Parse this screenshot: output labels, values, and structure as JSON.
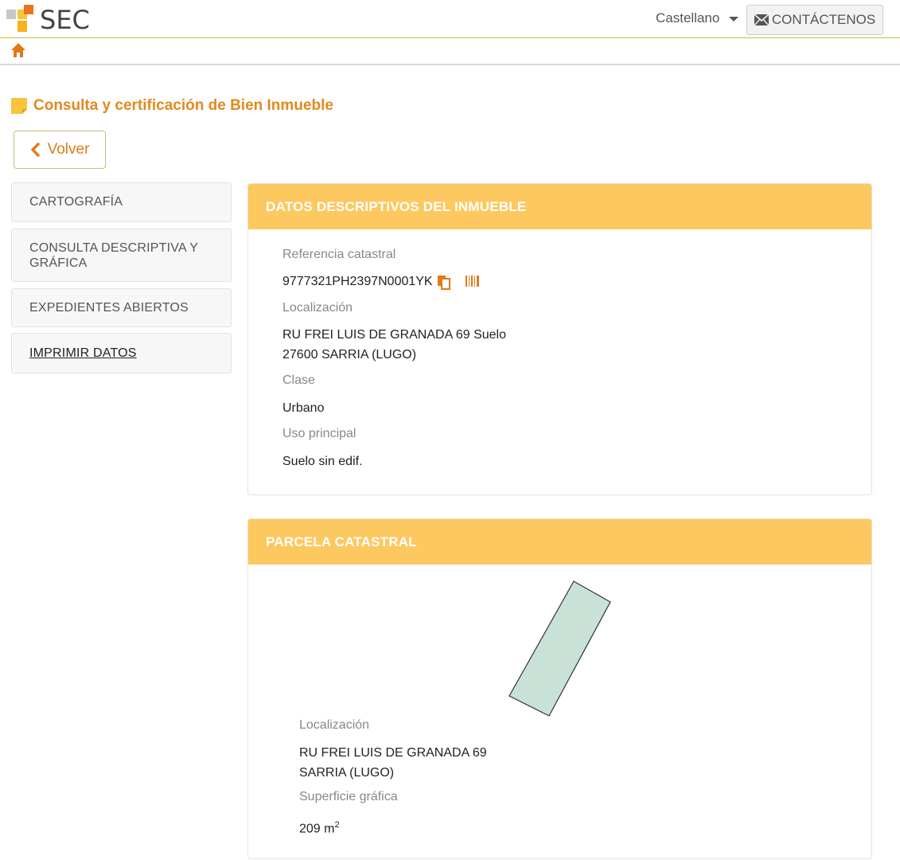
{
  "header": {
    "logo_text": "SEC",
    "language": "Castellano",
    "contact_label": "CONTÁCTENOS"
  },
  "page": {
    "title": "Consulta y certificación de Bien Inmueble",
    "back_label": "Volver"
  },
  "sidebar": {
    "items": [
      {
        "label": "CARTOGRAFÍA"
      },
      {
        "label": "CONSULTA DESCRIPTIVA Y GRÁFICA"
      },
      {
        "label": "EXPEDIENTES ABIERTOS"
      },
      {
        "label": "IMPRIMIR DATOS"
      }
    ]
  },
  "datos": {
    "header": "DATOS DESCRIPTIVOS DEL INMUEBLE",
    "ref_label": "Referencia catastral",
    "ref_value": "9777321PH2397N0001YK",
    "loc_label": "Localización",
    "loc_line1": "RU FREI LUIS DE GRANADA 69 Suelo",
    "loc_line2": "27600 SARRIA (LUGO)",
    "clase_label": "Clase",
    "clase_value": "Urbano",
    "uso_label": "Uso principal",
    "uso_value": "Suelo sin edif."
  },
  "parcela": {
    "header": "PARCELA CATASTRAL",
    "loc_label": "Localización",
    "loc_line1": "RU FREI LUIS DE GRANADA 69",
    "loc_line2": "SARRIA (LUGO)",
    "sup_label": "Superficie gráfica",
    "sup_value": "209 m",
    "sup_unit_exp": "2"
  },
  "colors": {
    "accent": "#e08a1e",
    "panel_header": "#fdc85f",
    "parcel_fill": "#c9e2d8"
  }
}
